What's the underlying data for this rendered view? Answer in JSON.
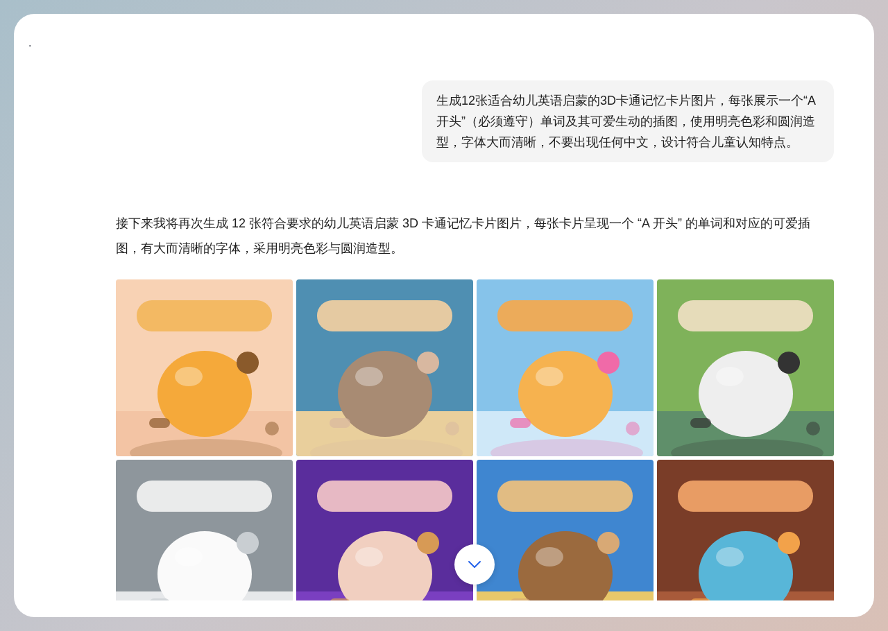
{
  "marker": ".",
  "user_message": "生成12张适合幼儿英语启蒙的3D卡通记忆卡片图片，每张展示一个“A开头”（必须遵守）单词及其可爱生动的插图，使用明亮色彩和圆润造型，字体大而清晰，不要出现任何中文，设计符合儿童认知特点。",
  "reply": {
    "text": "接下来我将再次生成 12 张符合要求的幼儿英语启蒙 3D 卡通记忆卡片图片，每张卡片呈现一个 “A 开头” 的单词和对应的可爱插图，有大而清晰的字体，采用明亮色彩与圆润造型。"
  },
  "scroll_down_button": {
    "kind": "chevron"
  }
}
